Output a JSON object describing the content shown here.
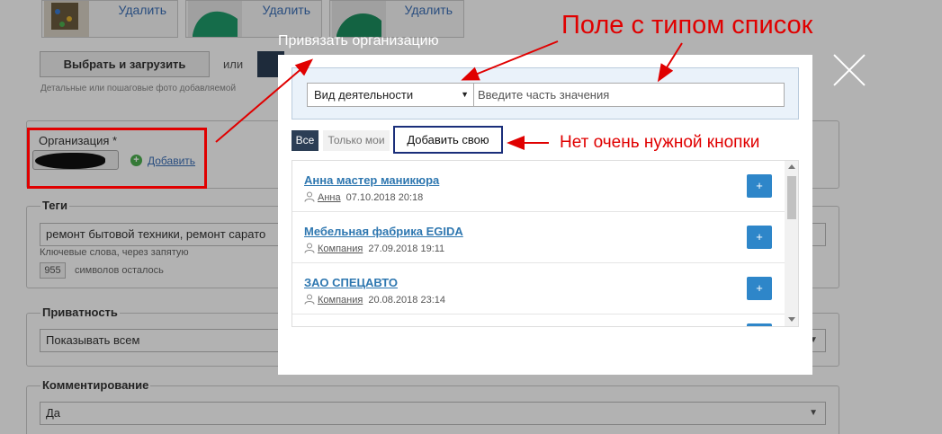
{
  "background": {
    "photos": [
      {
        "delete_label": "Удалить"
      },
      {
        "delete_label": "Удалить"
      },
      {
        "delete_label": "Удалить"
      }
    ],
    "upload_button": "Выбрать и загрузить",
    "or_text": "или",
    "photo_hint": "Детальные или пошаговые фото добавляемой",
    "organization": {
      "label": "Организация *",
      "add_link": "Добавить"
    },
    "tags": {
      "title": "Теги",
      "value": "ремонт бытовой техники, ремонт сарато",
      "hint": "Ключевые слова, через запятую",
      "counter": "955",
      "counter_text": "символов осталось"
    },
    "privacy": {
      "title": "Приватность",
      "value": "Показывать всем"
    },
    "comments": {
      "title": "Комментирование",
      "value": "Да"
    }
  },
  "modal": {
    "title": "Привязать организацию",
    "filter": {
      "type_selected": "Вид деятельности",
      "value_placeholder": "Введите часть значения"
    },
    "tabs": {
      "all": "Все",
      "mine": "Только мои"
    },
    "add_own_button": "Добавить свою",
    "items": [
      {
        "name": "Анна мастер маникюра",
        "author": "Анна",
        "date": "07.10.2018 20:18",
        "action": "+"
      },
      {
        "name": "Мебельная фабрика EGIDA",
        "author": "Компания",
        "date": "27.09.2018 19:11",
        "action": "+"
      },
      {
        "name": "ЗАО СПЕЦАВТО",
        "author": "Компания",
        "date": "20.08.2018 23:14",
        "action": "+"
      }
    ]
  },
  "annotations": {
    "field_type_note": "Поле с типом список",
    "missing_button_note": "Нет очень нужной кнопки",
    "color": "#e00000"
  },
  "colors": {
    "dark_tab": "#2c3e55",
    "link_blue": "#2e77b0",
    "plus_button": "#2e86c9",
    "filter_panel": "#eaf2fa"
  }
}
